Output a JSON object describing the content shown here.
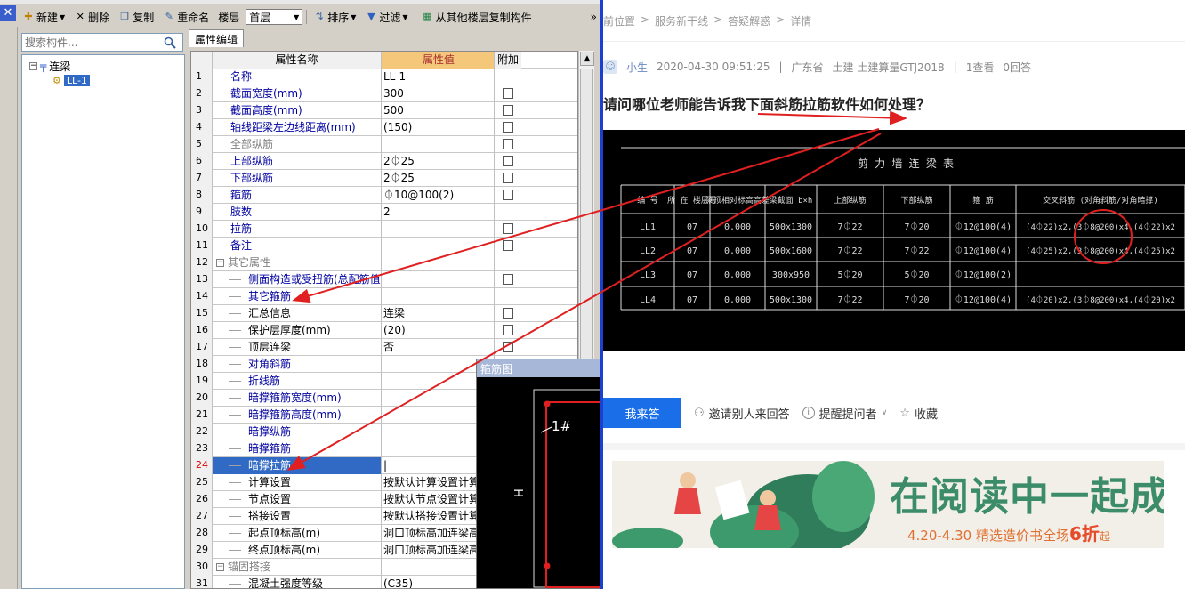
{
  "toolbar": {
    "new_label": "新建",
    "delete_label": "删除",
    "copy_label": "复制",
    "rename_label": "重命名",
    "floor_label": "楼层",
    "floor_value": "首层",
    "sort_label": "排序",
    "filter_label": "过滤",
    "copy_from_floor_label": "从其他楼层复制构件",
    "more_glyph": "»"
  },
  "search": {
    "placeholder": "搜索构件..."
  },
  "tree": {
    "root_label": "连梁",
    "child_label": "LL-1"
  },
  "panel": {
    "tab_label": "属性编辑"
  },
  "grid": {
    "headers": {
      "name": "属性名称",
      "value": "属性值",
      "add": "附加"
    },
    "rows": [
      {
        "num": "1",
        "name": "名称",
        "value": "LL-1"
      },
      {
        "num": "2",
        "name": "截面宽度(mm)",
        "value": "300"
      },
      {
        "num": "3",
        "name": "截面高度(mm)",
        "value": "500"
      },
      {
        "num": "4",
        "name": "轴线距梁左边线距离(mm)",
        "value": "(150)"
      },
      {
        "num": "5",
        "name": "全部纵筋",
        "value": ""
      },
      {
        "num": "6",
        "name": "上部纵筋",
        "value": "2⏀25"
      },
      {
        "num": "7",
        "name": "下部纵筋",
        "value": "2⏀25"
      },
      {
        "num": "8",
        "name": "箍筋",
        "value": "⏀10@100(2)"
      },
      {
        "num": "9",
        "name": "肢数",
        "value": "2"
      },
      {
        "num": "10",
        "name": "拉筋",
        "value": ""
      },
      {
        "num": "11",
        "name": "备注",
        "value": ""
      },
      {
        "num": "12",
        "name": "其它属性",
        "value": ""
      },
      {
        "num": "13",
        "name": "侧面构造或受扭筋(总配筋值)",
        "value": ""
      },
      {
        "num": "14",
        "name": "其它箍筋",
        "value": ""
      },
      {
        "num": "15",
        "name": "汇总信息",
        "value": "连梁"
      },
      {
        "num": "16",
        "name": "保护层厚度(mm)",
        "value": "(20)"
      },
      {
        "num": "17",
        "name": "顶层连梁",
        "value": "否"
      },
      {
        "num": "18",
        "name": "对角斜筋",
        "value": ""
      },
      {
        "num": "19",
        "name": "折线筋",
        "value": ""
      },
      {
        "num": "20",
        "name": "暗撑箍筋宽度(mm)",
        "value": ""
      },
      {
        "num": "21",
        "name": "暗撑箍筋高度(mm)",
        "value": ""
      },
      {
        "num": "22",
        "name": "暗撑纵筋",
        "value": ""
      },
      {
        "num": "23",
        "name": "暗撑箍筋",
        "value": ""
      },
      {
        "num": "24",
        "name": "暗撑拉筋",
        "value": "|"
      },
      {
        "num": "25",
        "name": "计算设置",
        "value": "按默认计算设置计算"
      },
      {
        "num": "26",
        "name": "节点设置",
        "value": "按默认节点设置计算"
      },
      {
        "num": "27",
        "name": "搭接设置",
        "value": "按默认搭接设置计算"
      },
      {
        "num": "28",
        "name": "起点顶标高(m)",
        "value": "洞口顶标高加连梁高度"
      },
      {
        "num": "29",
        "name": "终点顶标高(m)",
        "value": "洞口顶标高加连梁高度"
      },
      {
        "num": "30",
        "name": "锚固搭接",
        "value": ""
      },
      {
        "num": "31",
        "name": "混凝土强度等级",
        "value": "(C35)"
      }
    ]
  },
  "stirrup_window": {
    "title": "箍筋图",
    "label_1": "1#",
    "label_h": "H"
  },
  "qa": {
    "breadcrumb": [
      "前位置",
      ">",
      "服务新干线",
      ">",
      "答疑解惑",
      ">",
      "详情"
    ],
    "author": "小生",
    "datetime": "2020-04-30 09:51:25",
    "sep": "|",
    "region": "广东省",
    "tags": "土建 土建算量GTJ2018",
    "views": "1查看",
    "answers": "0回答",
    "question": "请问哪位老师能告诉我下面斜筋拉筋软件如何处理？",
    "answer_button": "我来答",
    "invite": "邀请别人来回答",
    "remind": "提醒提问者",
    "collect": "收藏"
  },
  "cad_table": {
    "title": "剪 力 墙 连 梁 表",
    "headers": [
      "编 号",
      "所 在 楼层号",
      "梁顶相对标高高差",
      "梁截面 b×h",
      "上部纵筋",
      "下部纵筋",
      "箍 筋",
      "交叉斜筋 (对角斜筋/对角暗撑)"
    ],
    "rows": [
      [
        "LL1",
        "07",
        "0.000",
        "500x1300",
        "7⏀22",
        "7⏀20",
        "⏀12@100(4)",
        "(4⏀22)x2,(3⏀8@200)x4,(4⏀22)x2"
      ],
      [
        "LL2",
        "07",
        "0.000",
        "500x1600",
        "7⏀22",
        "7⏀22",
        "⏀12@100(4)",
        "(4⏀25)x2,(3⏀8@200)x4,(4⏀25)x2"
      ],
      [
        "LL3",
        "07",
        "0.000",
        "300x950",
        "5⏀20",
        "5⏀20",
        "⏀12@100(2)",
        ""
      ],
      [
        "LL4",
        "07",
        "0.000",
        "500x1300",
        "7⏀22",
        "7⏀20",
        "⏀12@100(4)",
        "(4⏀20)x2,(3⏀8@200)x4,(4⏀20)x2"
      ]
    ]
  },
  "banner": {
    "main": "在阅读中一起成长",
    "sub": "4.20-4.30  精选造价书全场",
    "discount": "6折",
    "suffix": "起"
  },
  "colors": {
    "accent_blue": "#1a6fe8",
    "annotation_red": "#e02020",
    "banner_green": "#3c8c6a"
  }
}
